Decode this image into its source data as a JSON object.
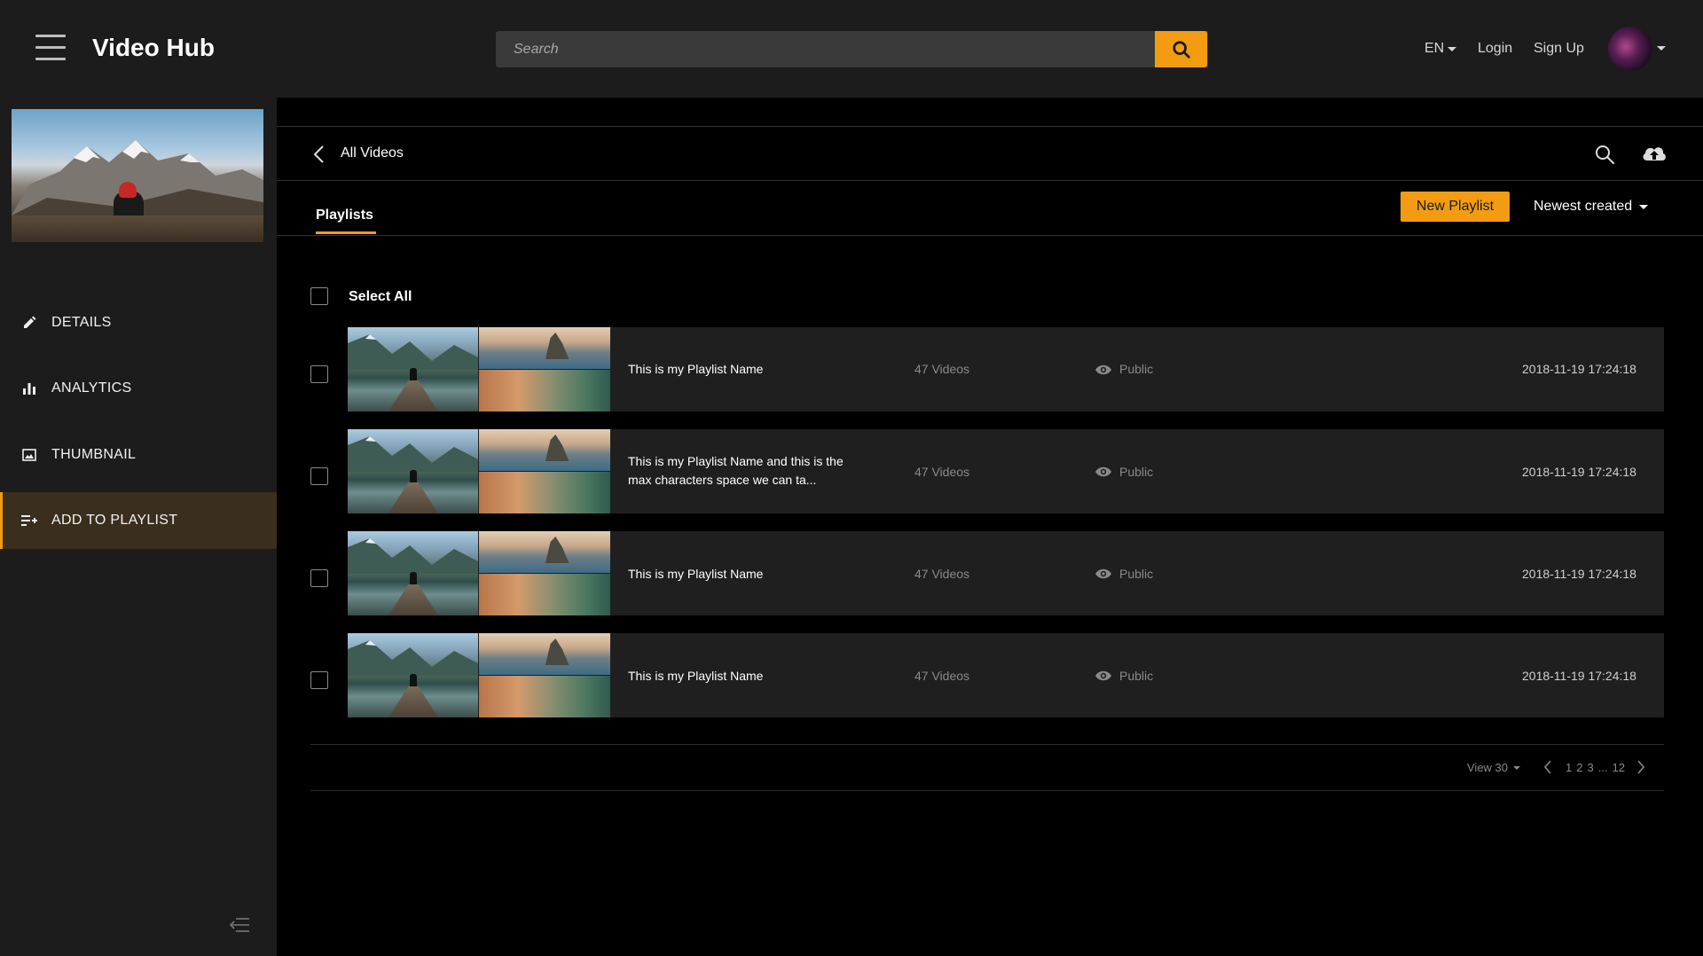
{
  "header": {
    "app_title": "Video Hub",
    "search_placeholder": "Search",
    "language": "EN",
    "login_label": "Login",
    "signup_label": "Sign Up",
    "accent_color": "#f39c12"
  },
  "sidebar": {
    "items": [
      {
        "label": "DETAILS",
        "icon": "pencil-icon"
      },
      {
        "label": "ANALYTICS",
        "icon": "bar-chart-icon"
      },
      {
        "label": "THUMBNAIL",
        "icon": "image-icon"
      },
      {
        "label": "ADD TO PLAYLIST",
        "icon": "playlist-add-icon",
        "active": true
      }
    ]
  },
  "main": {
    "back_label": "All Videos",
    "tab_label": "Playlists",
    "new_playlist_label": "New Playlist",
    "sort_label": "Newest created",
    "select_all_label": "Select All",
    "playlists": [
      {
        "title": "This is my Playlist Name",
        "count": "47 Videos",
        "visibility": "Public",
        "date": "2018-11-19 17:24:18"
      },
      {
        "title": "This is my Playlist Name and this is the max characters space we can ta...",
        "count": "47 Videos",
        "visibility": "Public",
        "date": "2018-11-19 17:24:18"
      },
      {
        "title": "This is my Playlist Name",
        "count": "47 Videos",
        "visibility": "Public",
        "date": "2018-11-19 17:24:18"
      },
      {
        "title": "This is my Playlist Name",
        "count": "47 Videos",
        "visibility": "Public",
        "date": "2018-11-19 17:24:18"
      }
    ],
    "pagination": {
      "view_label": "View 30",
      "pages": [
        "1",
        "2",
        "3",
        "...",
        "12"
      ]
    }
  }
}
